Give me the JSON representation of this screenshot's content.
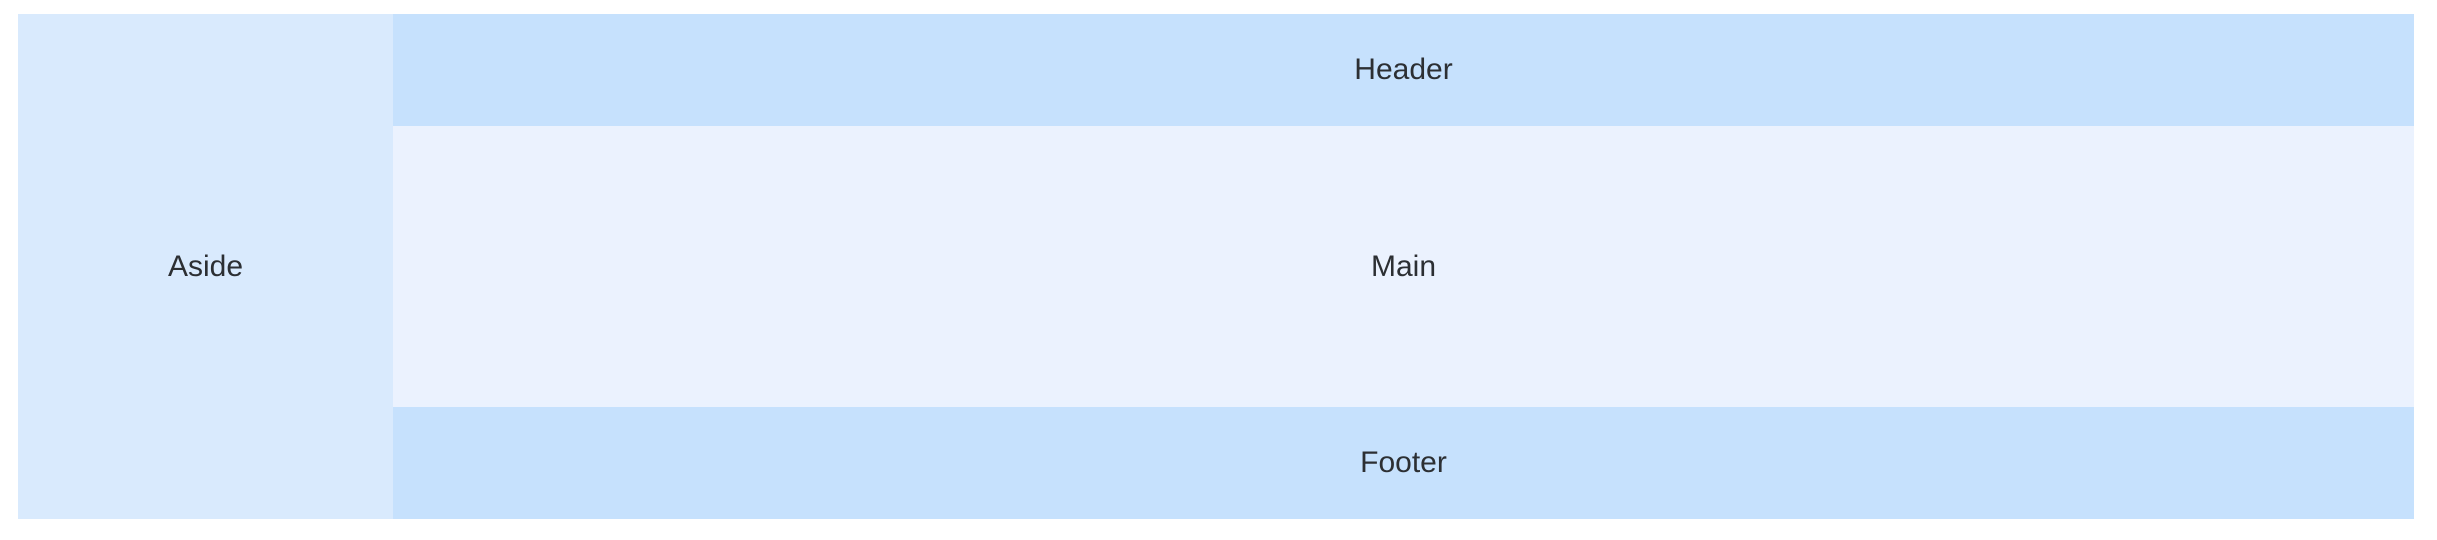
{
  "layout": {
    "aside_label": "Aside",
    "header_label": "Header",
    "main_label": "Main",
    "footer_label": "Footer"
  },
  "colors": {
    "aside_bg": "#d9eafd",
    "header_footer_bg": "#c6e1fd",
    "main_bg": "#ebf2fe",
    "text": "#2c2f33"
  }
}
